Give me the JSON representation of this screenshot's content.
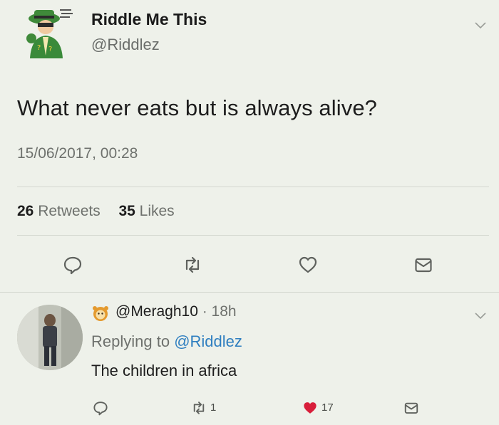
{
  "tweet": {
    "display_name": "Riddle Me This",
    "handle": "@Riddlez",
    "text": "What never eats but is always alive?",
    "timestamp": "15/06/2017, 00:28",
    "retweets_count": "26",
    "retweets_label": "Retweets",
    "likes_count": "35",
    "likes_label": "Likes",
    "actions": [
      "reply-icon",
      "retweet-icon",
      "like-icon",
      "direct-message-icon"
    ]
  },
  "reply": {
    "handle": "@Meragh10",
    "time": "· 18h",
    "replying_prefix": "Replying to",
    "replying_to": "@Riddlez",
    "text": "The children in africa",
    "retweet_count": "1",
    "like_count": "17",
    "like_color": "#d81e3a"
  },
  "colors": {
    "background": "#eef1ea",
    "mention": "#2f7fc0",
    "muted_text": "#6e716d"
  }
}
